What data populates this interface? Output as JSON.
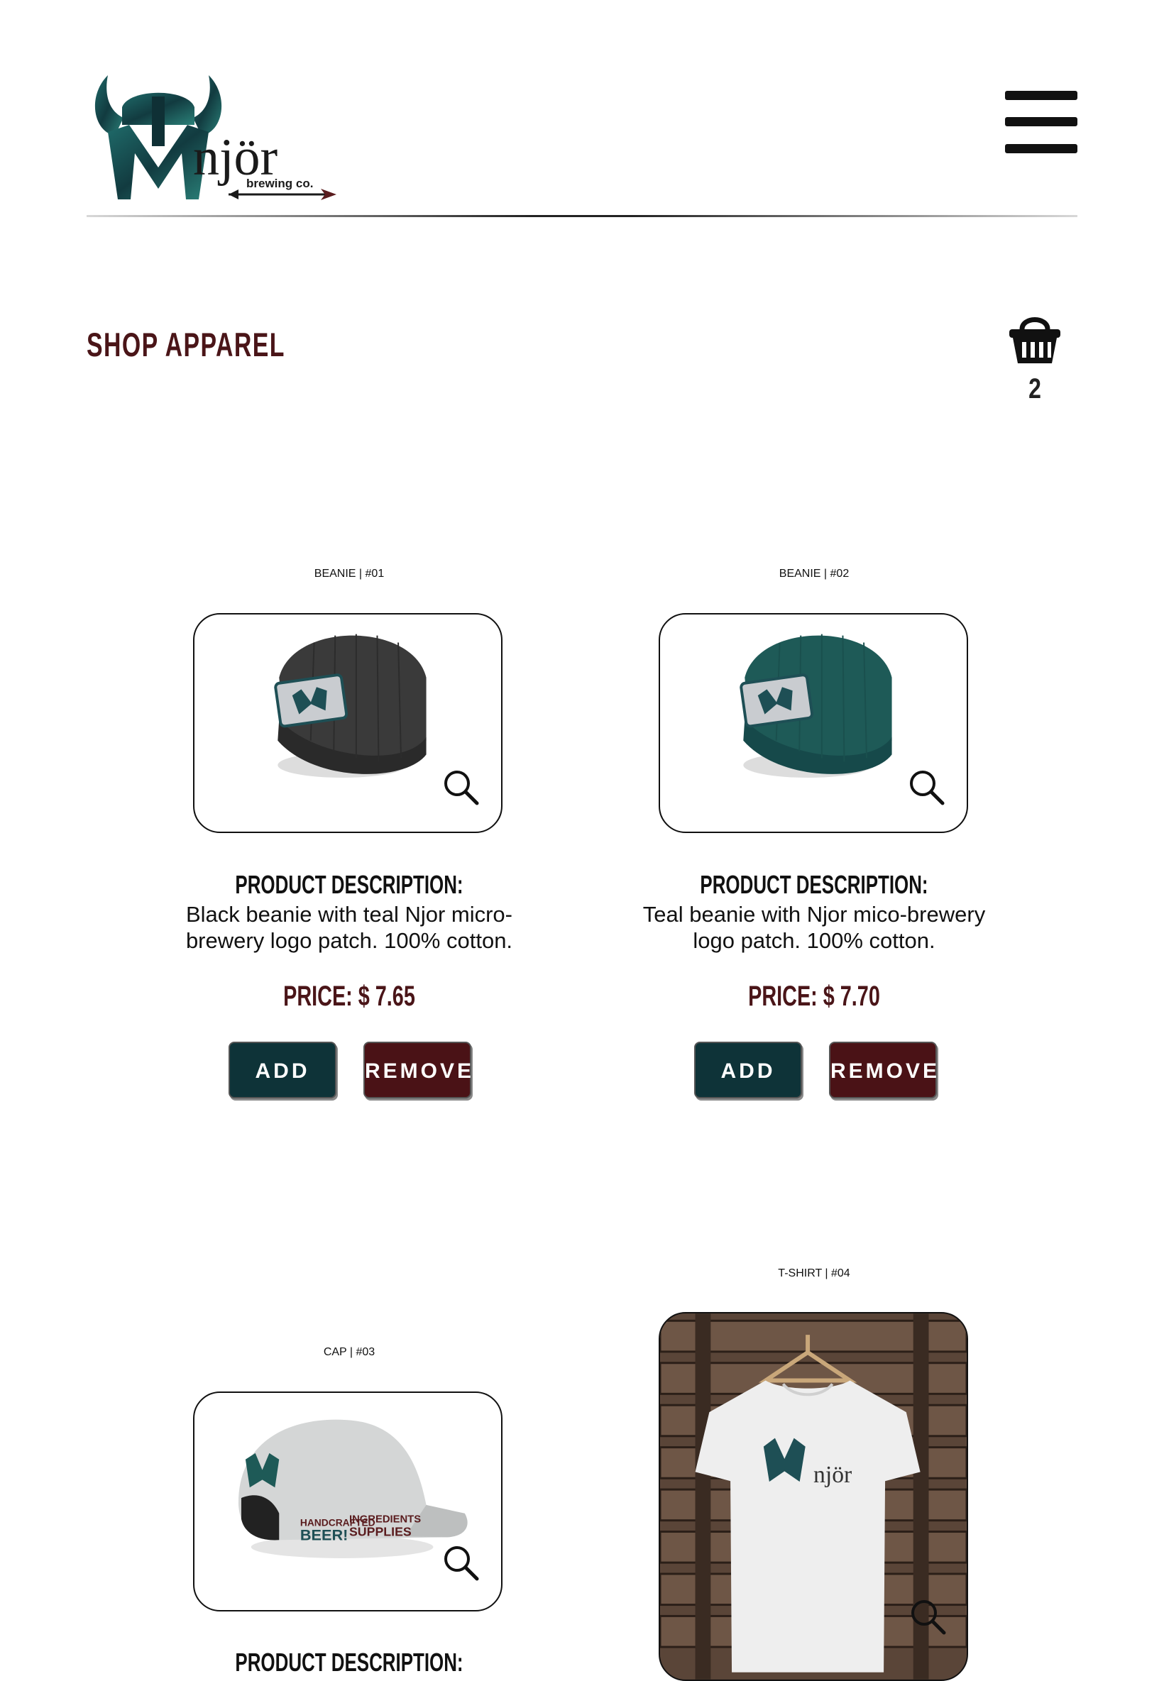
{
  "header": {
    "logo_text": "njör",
    "logo_sub": "brewing co."
  },
  "page": {
    "title": "SHOP APPAREL",
    "cart_count": "2"
  },
  "products": [
    {
      "title": "BEANIE | #01",
      "desc_heading": "PRODUCT DESCRIPTION:",
      "desc": "Black beanie with teal Njor micro-brewery logo patch. 100% cotton.",
      "price": "PRICE: $ 7.65",
      "add_label": "ADD",
      "remove_label": "REMOVE",
      "color": "#3a3a3a"
    },
    {
      "title": "BEANIE | #02",
      "desc_heading": "PRODUCT DESCRIPTION:",
      "desc": "Teal beanie with Njor mico-brewery logo patch. 100% cotton.",
      "price": "PRICE: $ 7.70",
      "add_label": "ADD",
      "remove_label": "REMOVE",
      "color": "#1e5a57"
    },
    {
      "title": "CAP | #03",
      "desc_heading": "PRODUCT DESCRIPTION:",
      "cap_text_1": "HANDCRAFTED",
      "cap_text_2": "BEER!",
      "cap_text_3": "INGREDIENTS",
      "cap_text_4": "SUPPLIES"
    },
    {
      "title": "T-SHIRT | #04",
      "shirt_logo_text": "njör"
    }
  ],
  "colors": {
    "title_maroon": "#4a1518",
    "add_teal": "#0e3338",
    "remove_maroon": "#4a1216"
  }
}
